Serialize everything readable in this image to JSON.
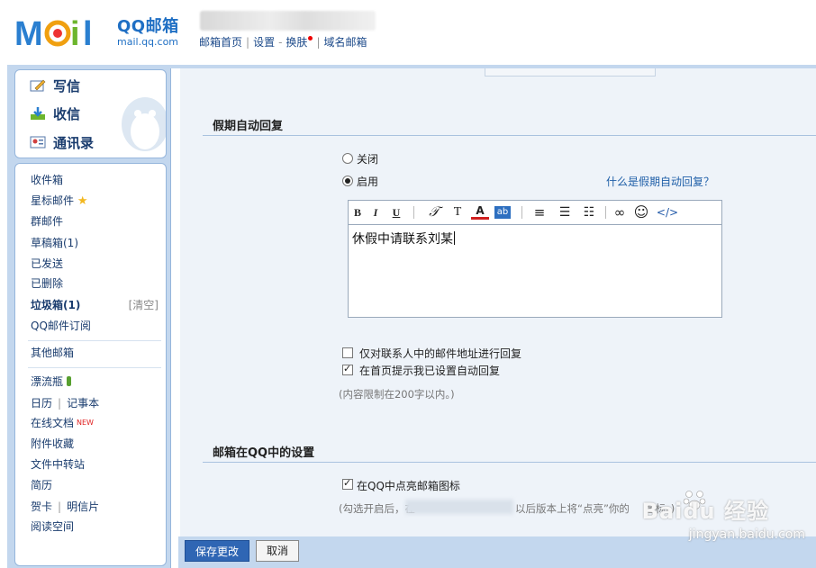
{
  "header": {
    "brand_qq": "QQ邮箱",
    "brand_url": "mail.qq.com",
    "links": [
      "邮箱首页",
      "设置",
      "换肤",
      "域名邮箱"
    ],
    "link_dash": "-"
  },
  "sidebar": {
    "primary": [
      {
        "label": "写信",
        "icon": "pencil-icon"
      },
      {
        "label": "收信",
        "icon": "inbox-download-icon"
      },
      {
        "label": "通讯录",
        "icon": "contact-card-icon"
      }
    ],
    "folders": {
      "inbox": "收件箱",
      "starred": "星标邮件",
      "group": "群邮件",
      "drafts": "草稿箱(1)",
      "sent": "已发送",
      "deleted": "已删除",
      "junk": "垃圾箱(1)",
      "junk_clear": "[清空]",
      "subscribe": "QQ邮件订阅",
      "other": "其他邮箱",
      "drift": "漂流瓶",
      "calendar": "日历",
      "notes": "记事本",
      "docs": "在线文档",
      "docs_new": "NEW",
      "attachments": "附件收藏",
      "transfer": "文件中转站",
      "resume": "简历",
      "cards": "贺卡",
      "postcards": "明信片",
      "reading": "阅读空间"
    }
  },
  "vacation": {
    "title": "假期自动回复",
    "off_label": "关闭",
    "on_label": "启用",
    "selected": "on",
    "help_link": "什么是假期自动回复？",
    "message": "休假中请联系刘某",
    "contacts_only_label": "仅对联系人中的邮件地址进行回复",
    "contacts_only_checked": false,
    "homepage_notice_label": "在首页提示我已设置自动回复",
    "homepage_notice_checked": true,
    "limit_hint": "(内容限制在200字以内。)"
  },
  "qq_settings": {
    "title": "邮箱在QQ中的设置",
    "light_icon_label": "在QQ中点亮邮箱图标",
    "light_icon_checked": true,
    "hint_start": "(勾选开启后，在",
    "hint_end": "以后版本上将“点亮”你的",
    "hint_tail": "图标。)"
  },
  "toolbar": {
    "bold": "B",
    "italic": "I",
    "underline": "U",
    "font": "𝒯",
    "size": "T",
    "color": "A",
    "bg": "ab",
    "align": "≡",
    "list_ul": "☰",
    "list_ol": "☷",
    "link": "∞",
    "emoji": "☺",
    "html": "</>"
  },
  "footer": {
    "save": "保存更改",
    "cancel": "取消"
  },
  "watermark": {
    "main": "Baidu 经验",
    "sub": "jingyan.baidu.com"
  },
  "colors": {
    "accent": "#2f66b4",
    "frame": "#c3d7ee",
    "link": "#1f5fa8"
  }
}
